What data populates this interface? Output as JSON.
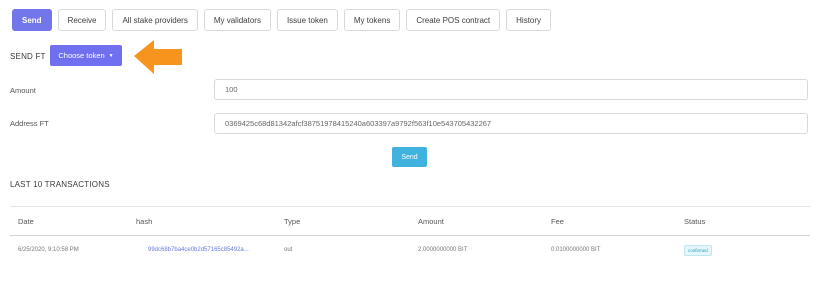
{
  "tabs": [
    {
      "label": "Send",
      "active": true
    },
    {
      "label": "Receive",
      "active": false
    },
    {
      "label": "All stake providers",
      "active": false
    },
    {
      "label": "My validators",
      "active": false
    },
    {
      "label": "Issue token",
      "active": false
    },
    {
      "label": "My tokens",
      "active": false
    },
    {
      "label": "Create POS contract",
      "active": false
    },
    {
      "label": "History",
      "active": false
    }
  ],
  "send_ft": {
    "title": "SEND FT",
    "choose_token_label": "Choose token",
    "amount_label": "Amount",
    "amount_value": "100",
    "address_label": "Address FT",
    "address_value": "0369425c68d81342afcf38751978415240a603397a9792f563f10e543705432267",
    "send_label": "Send"
  },
  "transactions": {
    "title": "LAST 10 TRANSACTIONS",
    "columns": [
      "Date",
      "hash",
      "Type",
      "Amount",
      "Fee",
      "Status"
    ],
    "rows": [
      {
        "date": "6/25/2020, 9:10:58 PM",
        "hash": "99dc68b7ba4ce0b2d57165c85492a...",
        "type": "out",
        "amount": "2.0000000000 BIT",
        "fee": "0.0100000000 BIT",
        "status": "confirmed"
      }
    ]
  },
  "colors": {
    "accent": "#7376ea",
    "send_button": "#3fb2dd",
    "arrow": "#f7941d"
  }
}
